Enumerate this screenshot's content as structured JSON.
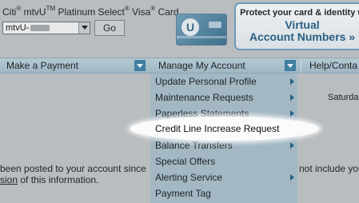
{
  "header": {
    "card_name_parts": [
      "Citi",
      "mtvU",
      "Platinum Select",
      "Visa",
      "Card"
    ],
    "account_select": {
      "value": "mtvU-"
    },
    "go_label": "Go",
    "card_logo_letter": "U",
    "promo": {
      "line1": "Protect your card & identity w",
      "title": "Virtual",
      "subtitle": "Account Numbers »"
    }
  },
  "nav": {
    "tabs": [
      {
        "label": "Make a Payment"
      },
      {
        "label": "Manage My Account"
      },
      {
        "label": "Help/Conta"
      }
    ]
  },
  "menu": {
    "items": [
      {
        "label": "Update Personal Profile",
        "has_submenu": true
      },
      {
        "label": "Maintenance Requests",
        "has_submenu": true
      },
      {
        "label": "Paperless Statements",
        "has_submenu": true
      },
      {
        "label": "Credit Line Increase Request",
        "has_submenu": false,
        "highlighted": true
      },
      {
        "label": "Balance Transfers",
        "has_submenu": true
      },
      {
        "label": "Special Offers",
        "has_submenu": false
      },
      {
        "label": "Alerting Service",
        "has_submenu": true
      },
      {
        "label": "Payment Tag",
        "has_submenu": false
      }
    ]
  },
  "body": {
    "saturday": "Saturda",
    "line1_left": "been posted to your account since",
    "line1_right": "not include you",
    "line2_link": "sion",
    "line2_rest": " of this information."
  },
  "colors": {
    "nav_bar": "#a9bfca",
    "menu_bg": "#a3b8c3",
    "accent": "#2b5f83",
    "arrow": "#1e5f86"
  }
}
